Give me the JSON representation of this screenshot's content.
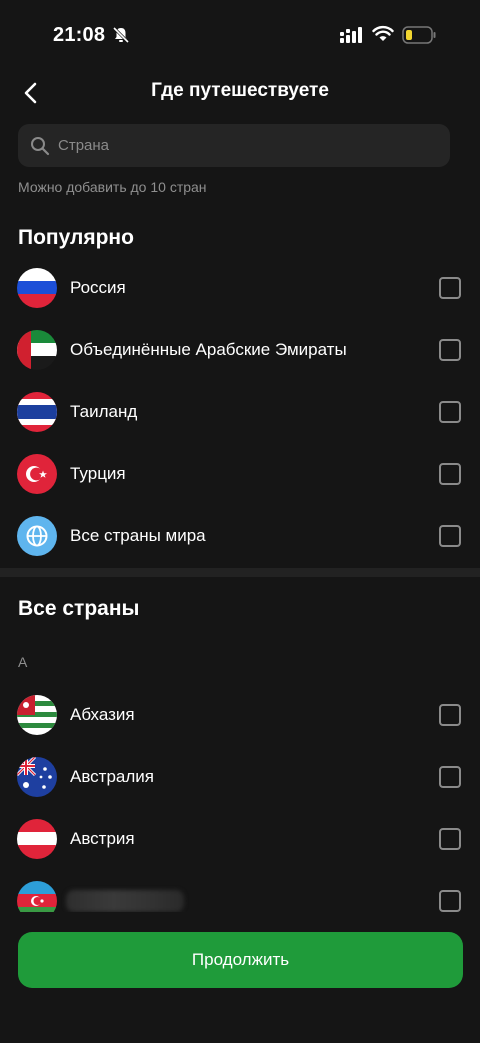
{
  "status_bar": {
    "time": "21:08",
    "icons": [
      "bell-mute-icon",
      "signal-icon",
      "wifi-icon",
      "battery-icon"
    ]
  },
  "header": {
    "title": "Где путешествуете",
    "back_icon": "chevron-left-icon"
  },
  "search": {
    "placeholder": "Страна",
    "value": "",
    "icon": "search-icon"
  },
  "hint": "Можно добавить до 10 стран",
  "popular": {
    "title": "Популярно",
    "items": [
      {
        "label": "Россия",
        "flag": "russia-flag-icon",
        "checked": false
      },
      {
        "label": "Объединённые Арабские Эмираты",
        "flag": "uae-flag-icon",
        "checked": false
      },
      {
        "label": "Таиланд",
        "flag": "thailand-flag-icon",
        "checked": false
      },
      {
        "label": "Турция",
        "flag": "turkey-flag-icon",
        "checked": false
      },
      {
        "label": "Все страны мира",
        "flag": "globe-icon",
        "checked": false
      }
    ]
  },
  "all_countries": {
    "title": "Все страны",
    "letter": "А",
    "items": [
      {
        "label": "Абхазия",
        "flag": "abkhazia-flag-icon",
        "checked": false
      },
      {
        "label": "Австралия",
        "flag": "australia-flag-icon",
        "checked": false
      },
      {
        "label": "Австрия",
        "flag": "austria-flag-icon",
        "checked": false
      },
      {
        "label": "",
        "flag": "azerbaijan-flag-icon",
        "checked": false
      }
    ]
  },
  "continue_button": "Продолжить",
  "colors": {
    "background": "#151515",
    "surface": "#252525",
    "accent": "#1f9b3a",
    "muted_text": "#8f8f8f"
  }
}
